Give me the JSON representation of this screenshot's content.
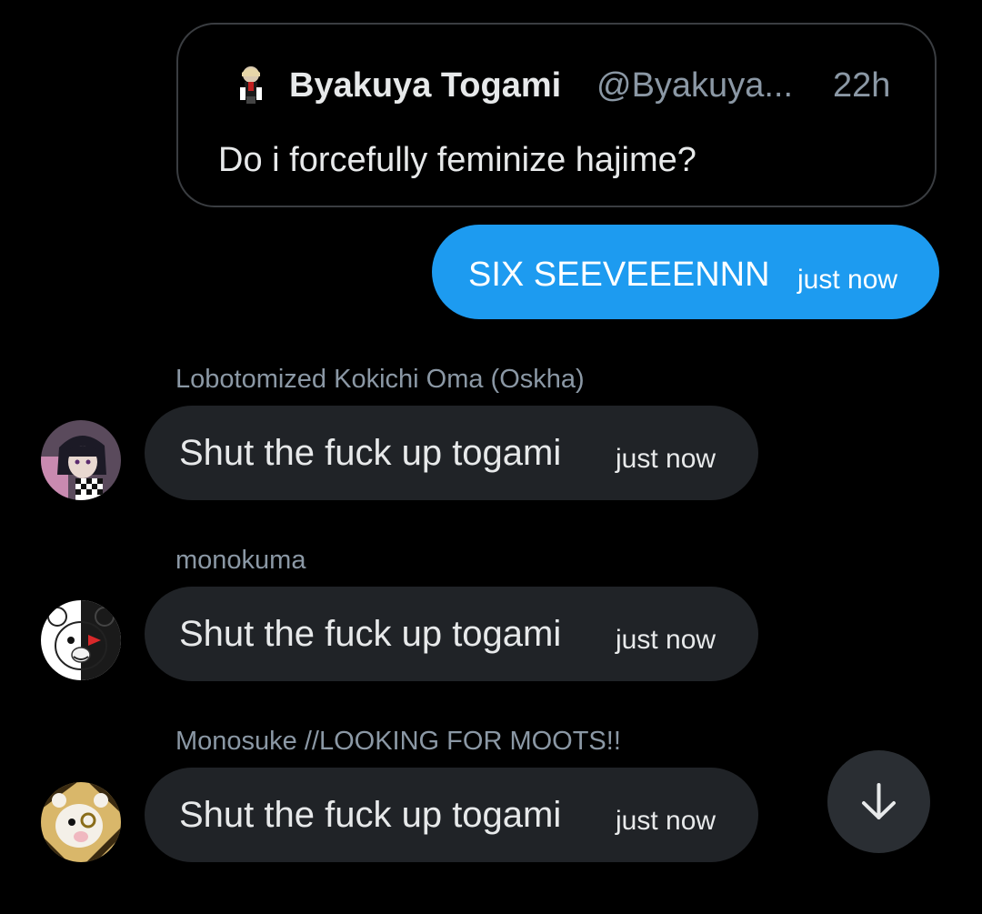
{
  "quoted_tweet": {
    "name": "Byakuya Togami",
    "handle": "@Byakuya...",
    "time": "22h",
    "text": "Do i forcefully feminize hajime?",
    "avatar_icon": "anime-character-avatar-icon"
  },
  "sent_message": {
    "text": "SIX SEEVEEENNN",
    "time": "just now",
    "bubble_color": "#1d9bf0"
  },
  "messages": [
    {
      "sender": "Lobotomized Kokichi Oma (Oskha)",
      "text": "Shut the fuck up togami",
      "time": "just now",
      "avatar_icon": "kokichi-avatar-icon"
    },
    {
      "sender": "monokuma",
      "text": "Shut the fuck up togami",
      "time": "just now",
      "avatar_icon": "monokuma-avatar-icon"
    },
    {
      "sender": "Monosuke //LOOKING FOR MOOTS!!",
      "text": "Shut the fuck up togami",
      "time": "just now",
      "avatar_icon": "monosuke-avatar-icon"
    }
  ],
  "scroll_button": {
    "icon": "arrow-down-icon"
  },
  "colors": {
    "background": "#000000",
    "received_bubble": "#202327",
    "secondary_text": "#8b98a5"
  }
}
